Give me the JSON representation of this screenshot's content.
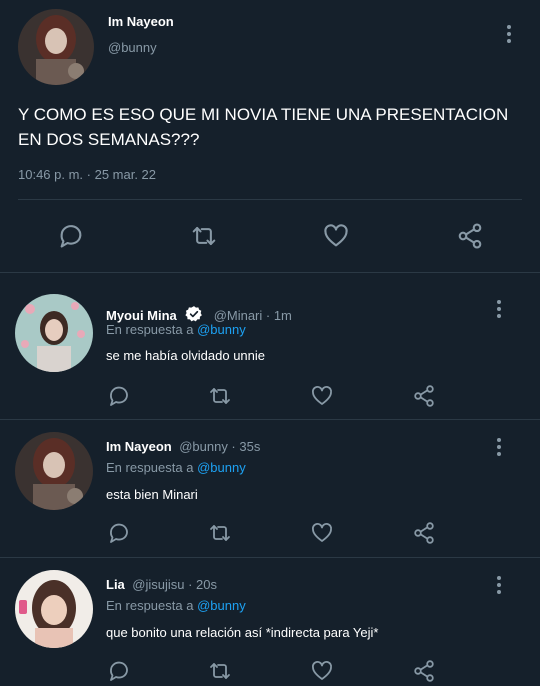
{
  "main_tweet": {
    "name": "Im Nayeon",
    "handle": "@bunny",
    "text": "Y COMO ES ESO QUE MI NOVIA TIENE UNA PRESENTACION EN DOS SEMANAS???",
    "timestamp": "10:46 p. m. · 25 mar. 22"
  },
  "replies": [
    {
      "name": "Myoui Mina",
      "verified": true,
      "handle": "@Minari · 1m",
      "reply_prefix": "En respuesta a",
      "reply_to": "@bunny",
      "text": "se me había olvidado unnie"
    },
    {
      "name": "Im Nayeon",
      "verified": false,
      "handle": "@bunny · 35s",
      "reply_prefix": "En respuesta a",
      "reply_to": "@bunny",
      "text": "esta bien Minari"
    },
    {
      "name": "Lia",
      "verified": false,
      "handle": "@jisujisu · 20s",
      "reply_prefix": "En respuesta a",
      "reply_to": "@bunny",
      "text": "que bonito una relación así *indirecta para Yeji*"
    }
  ],
  "icons": {
    "reply": "comment-icon",
    "retweet": "retweet-icon",
    "like": "heart-icon",
    "share": "share-icon",
    "more": "more-vertical-icon",
    "verified": "verified-badge-icon"
  },
  "colors": {
    "background": "#15202b",
    "muted": "#8899a6",
    "link": "#1da1f2",
    "divider": "#2b3945"
  }
}
